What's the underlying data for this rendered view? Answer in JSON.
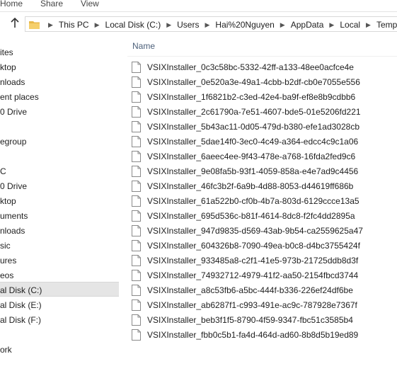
{
  "ribbon": {
    "tabs": [
      "Home",
      "Share",
      "View"
    ]
  },
  "address_bar": {
    "crumbs": [
      "This PC",
      "Local Disk (C:)",
      "Users",
      "Hai%20Nguyen",
      "AppData",
      "Local",
      "Temp"
    ]
  },
  "sidebar": {
    "items": [
      {
        "label": "ites",
        "selected": false
      },
      {
        "label": "ktop",
        "selected": false
      },
      {
        "label": "nloads",
        "selected": false
      },
      {
        "label": "ent places",
        "selected": false
      },
      {
        "label": "0 Drive",
        "selected": false
      },
      {
        "label": "egroup",
        "selected": false
      },
      {
        "label": "C",
        "selected": false
      },
      {
        "label": "0 Drive",
        "selected": false
      },
      {
        "label": "ktop",
        "selected": false
      },
      {
        "label": "uments",
        "selected": false
      },
      {
        "label": "nloads",
        "selected": false
      },
      {
        "label": "sic",
        "selected": false
      },
      {
        "label": "ures",
        "selected": false
      },
      {
        "label": "eos",
        "selected": false
      },
      {
        "label": "al Disk (C:)",
        "selected": true
      },
      {
        "label": "al Disk (E:)",
        "selected": false
      },
      {
        "label": "al Disk (F:)",
        "selected": false
      },
      {
        "label": "ork",
        "selected": false
      }
    ]
  },
  "file_list": {
    "column_name": "Name",
    "files": [
      "VSIXInstaller_0c3c58bc-5332-42ff-a133-48ee0acfce4e",
      "VSIXInstaller_0e520a3e-49a1-4cbb-b2df-cb0e7055e556",
      "VSIXInstaller_1f6821b2-c3ed-42e4-ba9f-ef8e8b9cdbb6",
      "VSIXInstaller_2c61790a-7e51-4607-bde5-01e5206fd221",
      "VSIXInstaller_5b43ac11-0d05-479d-b380-efe1ad3028cb",
      "VSIXInstaller_5dae14f0-3ec0-4c49-a364-edcc4c9c1a06",
      "VSIXInstaller_6aeec4ee-9f43-478e-a768-16fda2fed9c6",
      "VSIXInstaller_9e08fa5b-93f1-4059-858a-e4e7ad9c4456",
      "VSIXInstaller_46fc3b2f-6a9b-4d88-8053-d44619ff686b",
      "VSIXInstaller_61a522b0-cf0b-4b7a-803d-6129ccce13a5",
      "VSIXInstaller_695d536c-b81f-4614-8dc8-f2fc4dd2895a",
      "VSIXInstaller_947d9835-d569-43ab-9b54-ca2559625a47",
      "VSIXInstaller_604326b8-7090-49ea-b0c8-d4bc3755424f",
      "VSIXInstaller_933485a8-c2f1-41e5-973b-21725ddb8d3f",
      "VSIXInstaller_74932712-4979-41f2-aa50-2154fbcd3744",
      "VSIXInstaller_a8c53fb6-a5bc-444f-b336-226ef24df6be",
      "VSIXInstaller_ab6287f1-c993-491e-ac9c-787928e7367f",
      "VSIXInstaller_beb3f1f5-8790-4f59-9347-fbc51c3585b4",
      "VSIXInstaller_fbb0c5b1-fa4d-464d-ad60-8b8d5b19ed89"
    ]
  },
  "icons": {
    "folder": "folder-icon",
    "up": "up-arrow-icon",
    "separator": "chevron-right-icon",
    "file": "text-file-icon"
  },
  "colors": {
    "header_text": "#4c607a",
    "selected_bg": "#e5e5e5",
    "folder_yellow": "#e8b84a"
  }
}
